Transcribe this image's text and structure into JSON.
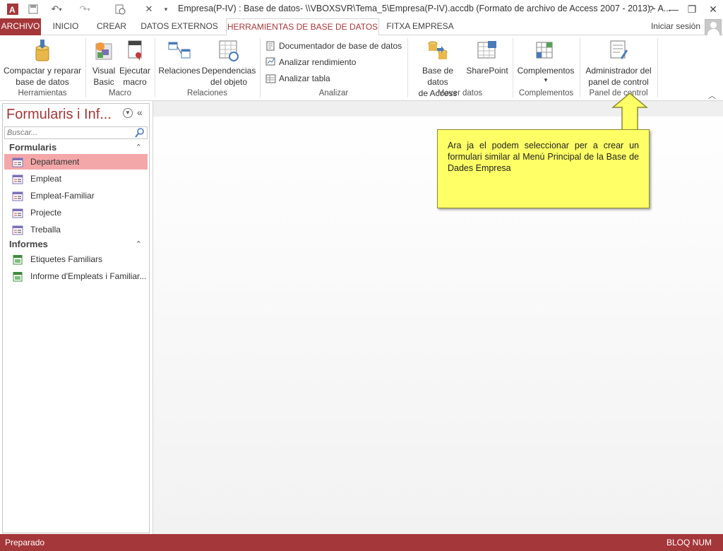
{
  "window": {
    "title": "Empresa(P-IV) : Base de datos- \\\\VBOXSVR\\Tema_5\\Empresa(P-IV).accdb (Formato de archivo de Access 2007 - 2013) - A...",
    "help": "?",
    "restore": "❐",
    "minimize": "—",
    "close": "✕"
  },
  "tabs": [
    {
      "label": "ARCHIVO"
    },
    {
      "label": "INICIO"
    },
    {
      "label": "CREAR"
    },
    {
      "label": "DATOS EXTERNOS"
    },
    {
      "label": "HERRAMIENTAS DE BASE DE DATOS"
    },
    {
      "label": "FITXA EMPRESA"
    }
  ],
  "active_tab_index": 4,
  "signin": "Iniciar sesión",
  "ribbon": {
    "herramientas": {
      "label": "Herramientas",
      "compact": "Compactar y reparar\nbase de datos"
    },
    "macro": {
      "label": "Macro",
      "vb": "Visual\nBasic",
      "run": "Ejecutar\nmacro"
    },
    "relaciones": {
      "label": "Relaciones",
      "rel": "Relaciones",
      "dep": "Dependencias\ndel objeto"
    },
    "analizar": {
      "label": "Analizar",
      "doc": "Documentador de base de datos",
      "perf": "Analizar rendimiento",
      "table": "Analizar tabla"
    },
    "mover": {
      "label": "Mover datos",
      "access": "Base de datos\nde Access",
      "sharepoint": "SharePoint"
    },
    "complementos": {
      "label": "Complementos",
      "btn": "Complementos",
      "arrow": "▾"
    },
    "panel": {
      "label": "Panel de control",
      "admin": "Administrador del\npanel de control"
    }
  },
  "nav": {
    "title": "Formularis i Inf...",
    "search_placeholder": "Buscar...",
    "categories": [
      {
        "label": "Formularis",
        "items": [
          "Departament",
          "Empleat",
          "Empleat-Familiar",
          "Projecte",
          "Treballa"
        ]
      },
      {
        "label": "Informes",
        "items": [
          "Etiquetes Familiars",
          "Informe d'Empleats i Familiar..."
        ]
      }
    ],
    "selected_item": "Departament"
  },
  "callout": {
    "text": "Ara ja el podem seleccionar per a crear un formulari similar al Menú Principal de la Base de Dades Empresa"
  },
  "status": {
    "left": "Preparado",
    "right": "BLOQ NUM"
  },
  "colors": {
    "accent": "#a4373a",
    "selected": "#f4a7a9",
    "callout": "#ffff66"
  }
}
